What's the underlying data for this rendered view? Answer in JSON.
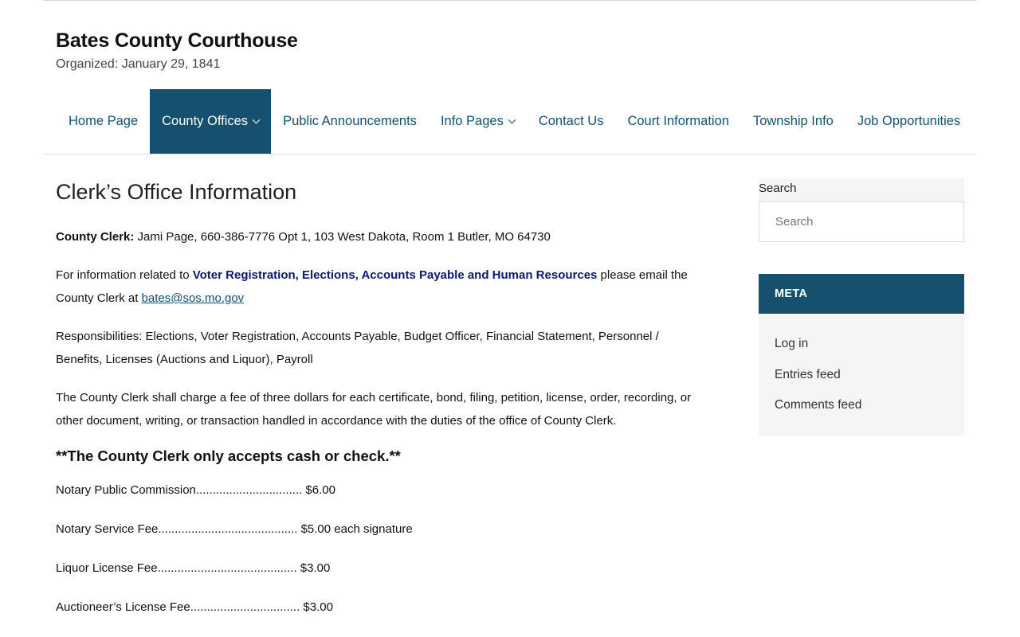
{
  "site": {
    "title": "Bates County Courthouse",
    "tagline": "Organized: January 29, 1841"
  },
  "nav": {
    "items": [
      {
        "label": "Home Page"
      },
      {
        "label": "County Offices"
      },
      {
        "label": "Public Announcements"
      },
      {
        "label": "Info Pages"
      },
      {
        "label": "Contact Us"
      },
      {
        "label": "Court Information"
      },
      {
        "label": "Township Info"
      },
      {
        "label": "Job Opportunities"
      }
    ]
  },
  "main": {
    "title": "Clerk’s Office Information",
    "clerk_label": "County Clerk:",
    "clerk_text": " Jami Page, 660-386-7776 Opt 1, 103 West Dakota, Room 1 Butler, MO 64730",
    "info_prefix": "For information related to ",
    "info_highlight": "Voter Registration, Elections, Accounts Payable and Human Resources",
    "info_suffix": " please email the County Clerk at ",
    "email": "bates@sos.mo.gov",
    "responsibilities": "Responsibilities: Elections, Voter Registration, Accounts Payable, Budget Officer, Financial Statement, Personnel / Benefits, Licenses (Auctions and Liquor), Payroll",
    "fee_statement": "The County Clerk shall charge a fee of three dollars for each certificate, bond, filing, petition, license, order, recording, or other document, writing, or transaction handled in accordance with the duties of the office of County Clerk.",
    "notice": "**The County Clerk only accepts cash or check.**",
    "fees": [
      {
        "text": "Notary Public Commission................................ $6.00"
      },
      {
        "text": "Notary Service Fee.......................................... $5.00 each signature"
      },
      {
        "text": "Liquor License Fee.......................................... $3.00"
      },
      {
        "text": "Auctioneer’s License Fee................................. $3.00"
      }
    ]
  },
  "sidebar": {
    "search_label": "Search",
    "search_placeholder": "Search",
    "meta_title": "META",
    "meta_links": [
      {
        "label": "Log in"
      },
      {
        "label": "Entries feed"
      },
      {
        "label": "Comments feed"
      }
    ]
  },
  "colors": {
    "brand": "#15506f",
    "highlight_text": "#0a1a6e"
  }
}
